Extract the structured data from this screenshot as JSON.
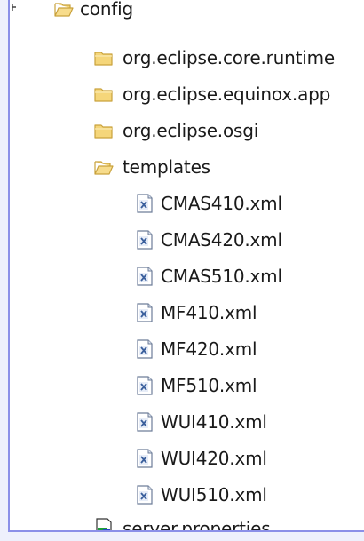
{
  "tree": {
    "config": {
      "label": "config",
      "icon": "folder-open-icon"
    },
    "config_children": [
      {
        "label": "org.eclipse.core.runtime",
        "icon": "folder-icon"
      },
      {
        "label": "org.eclipse.equinox.app",
        "icon": "folder-icon"
      },
      {
        "label": "org.eclipse.osgi",
        "icon": "folder-icon"
      }
    ],
    "templates": {
      "label": "templates",
      "icon": "folder-open-icon"
    },
    "template_files": [
      {
        "label": "CMAS410.xml",
        "icon": "xml-file-icon"
      },
      {
        "label": "CMAS420.xml",
        "icon": "xml-file-icon"
      },
      {
        "label": "CMAS510.xml",
        "icon": "xml-file-icon"
      },
      {
        "label": "MF410.xml",
        "icon": "xml-file-icon"
      },
      {
        "label": "MF420.xml",
        "icon": "xml-file-icon"
      },
      {
        "label": "MF510.xml",
        "icon": "xml-file-icon"
      },
      {
        "label": "WUI410.xml",
        "icon": "xml-file-icon"
      },
      {
        "label": "WUI420.xml",
        "icon": "xml-file-icon"
      },
      {
        "label": "WUI510.xml",
        "icon": "xml-file-icon"
      }
    ],
    "server_properties": {
      "label": "server.properties",
      "icon": "properties-file-icon"
    }
  },
  "colors": {
    "folder_fill": "#f5d67a",
    "folder_stroke": "#c9a23c",
    "frame_line": "#8b8fe8",
    "frame_fill": "#eef0fc",
    "xml_letter": "#3a5f9c"
  }
}
